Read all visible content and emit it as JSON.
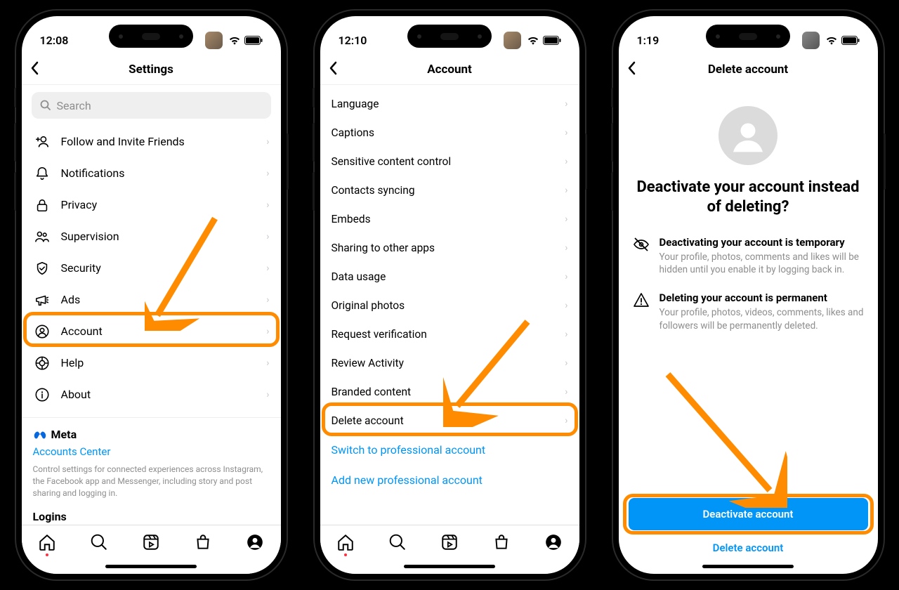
{
  "phone1": {
    "time": "12:08",
    "title": "Settings",
    "search_placeholder": "Search",
    "items": [
      "Follow and Invite Friends",
      "Notifications",
      "Privacy",
      "Supervision",
      "Security",
      "Ads",
      "Account",
      "Help",
      "About"
    ],
    "meta": "Meta",
    "accounts_center": "Accounts Center",
    "footer_desc": "Control settings for connected experiences across Instagram, the Facebook app and Messenger, including story and post sharing and logging in.",
    "logins": "Logins",
    "highlight_index": 6
  },
  "phone2": {
    "time": "12:10",
    "title": "Account",
    "items": [
      "Language",
      "Captions",
      "Sensitive content control",
      "Contacts syncing",
      "Embeds",
      "Sharing to other apps",
      "Data usage",
      "Original photos",
      "Request verification",
      "Review Activity",
      "Branded content",
      "Delete account"
    ],
    "links": [
      "Switch to professional account",
      "Add new professional account"
    ],
    "highlight_index": 11
  },
  "phone3": {
    "time": "1:19",
    "title": "Delete account",
    "big_title": "Deactivate your account instead of deleting?",
    "info1_title": "Deactivating your account is temporary",
    "info1_desc": "Your profile, photos, comments and likes will be hidden until you enable it by logging back in.",
    "info2_title": "Deleting your account is permanent",
    "info2_desc": "Your profile, photos, videos, comments, likes and followers will be permanently deleted.",
    "primary_btn": "Deactivate account",
    "secondary_link": "Delete account"
  }
}
